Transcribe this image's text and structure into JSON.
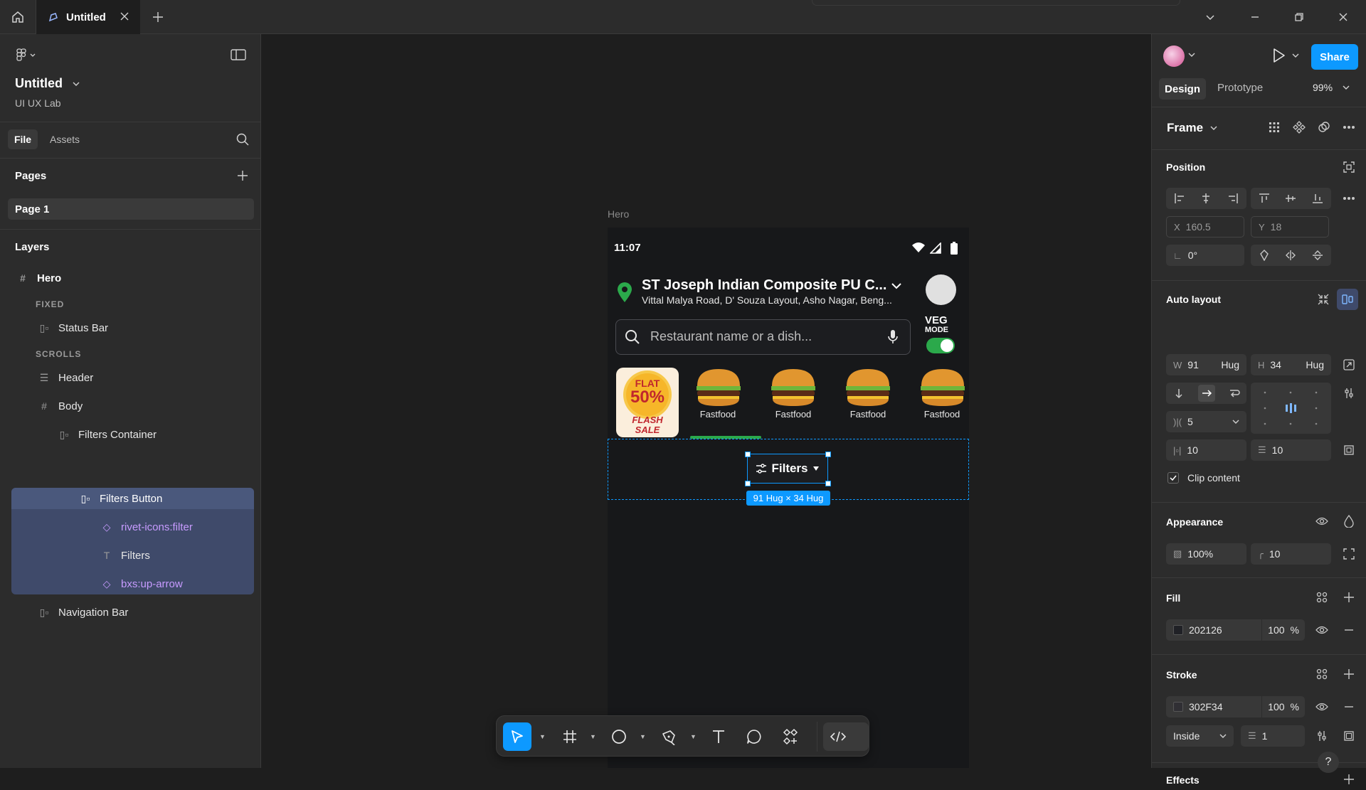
{
  "titlebar": {
    "tab_title": "Untitled"
  },
  "left_panel": {
    "file_name": "Untitled",
    "team_name": "UI UX Lab",
    "tabs": [
      "File",
      "Assets"
    ],
    "pages_heading": "Pages",
    "pages": [
      "Page 1"
    ],
    "layers_heading": "Layers",
    "layers": {
      "hero": "Hero",
      "fixed_label": "FIXED",
      "status_bar": "Status Bar",
      "scrolls_label": "SCROLLS",
      "header": "Header",
      "body": "Body",
      "filters_container": "Filters Container",
      "filters_button": "Filters Button",
      "rivet_icon": "rivet-icons:filter",
      "filters_text": "Filters",
      "bxs_icon": "bxs:up-arrow",
      "navigation_bar": "Navigation Bar"
    }
  },
  "canvas": {
    "frame_label": "Hero",
    "phone": {
      "time": "11:07",
      "location_title": "ST Joseph Indian Composite PU C...",
      "location_subtitle": "Vittal Malya Road, D' Souza Layout, Asho Nagar, Beng...",
      "search_placeholder": "Restaurant name or a dish...",
      "veg_label": "VEG",
      "mode_label": "MODE",
      "promo": {
        "line1": "FLAT",
        "line2": "50%",
        "line3": "FLASH",
        "line4": "SALE"
      },
      "categories": [
        "Fastfood",
        "Fastfood",
        "Fastfood",
        "Fastfood"
      ],
      "filters_label": "Filters",
      "size_badge": "91 Hug × 34 Hug"
    }
  },
  "right_panel": {
    "tabs": [
      "Design",
      "Prototype"
    ],
    "zoom": "99%",
    "share_label": "Share",
    "frame_label": "Frame",
    "position": {
      "heading": "Position",
      "x_label": "X",
      "x": "160.5",
      "y_label": "Y",
      "y": "18",
      "rotation": "0°"
    },
    "auto_layout": {
      "heading": "Auto layout",
      "w_label": "W",
      "w": "91",
      "w_mode": "Hug",
      "h_label": "H",
      "h": "34",
      "h_mode": "Hug",
      "gap": "5",
      "padding_h": "10",
      "padding_v": "10",
      "clip_content": "Clip content"
    },
    "appearance": {
      "heading": "Appearance",
      "opacity": "100%",
      "radius": "10"
    },
    "fill": {
      "heading": "Fill",
      "hex": "202126",
      "opacity": "100",
      "pct": "%"
    },
    "stroke": {
      "heading": "Stroke",
      "hex": "302F34",
      "opacity": "100",
      "pct": "%",
      "position": "Inside",
      "weight": "1"
    },
    "effects": {
      "heading": "Effects"
    }
  },
  "colors": {
    "accent": "#0d99ff",
    "selection_bg": "#3f4a6a",
    "veg_green": "#2ba94b",
    "component_purple": "#c79bff"
  }
}
